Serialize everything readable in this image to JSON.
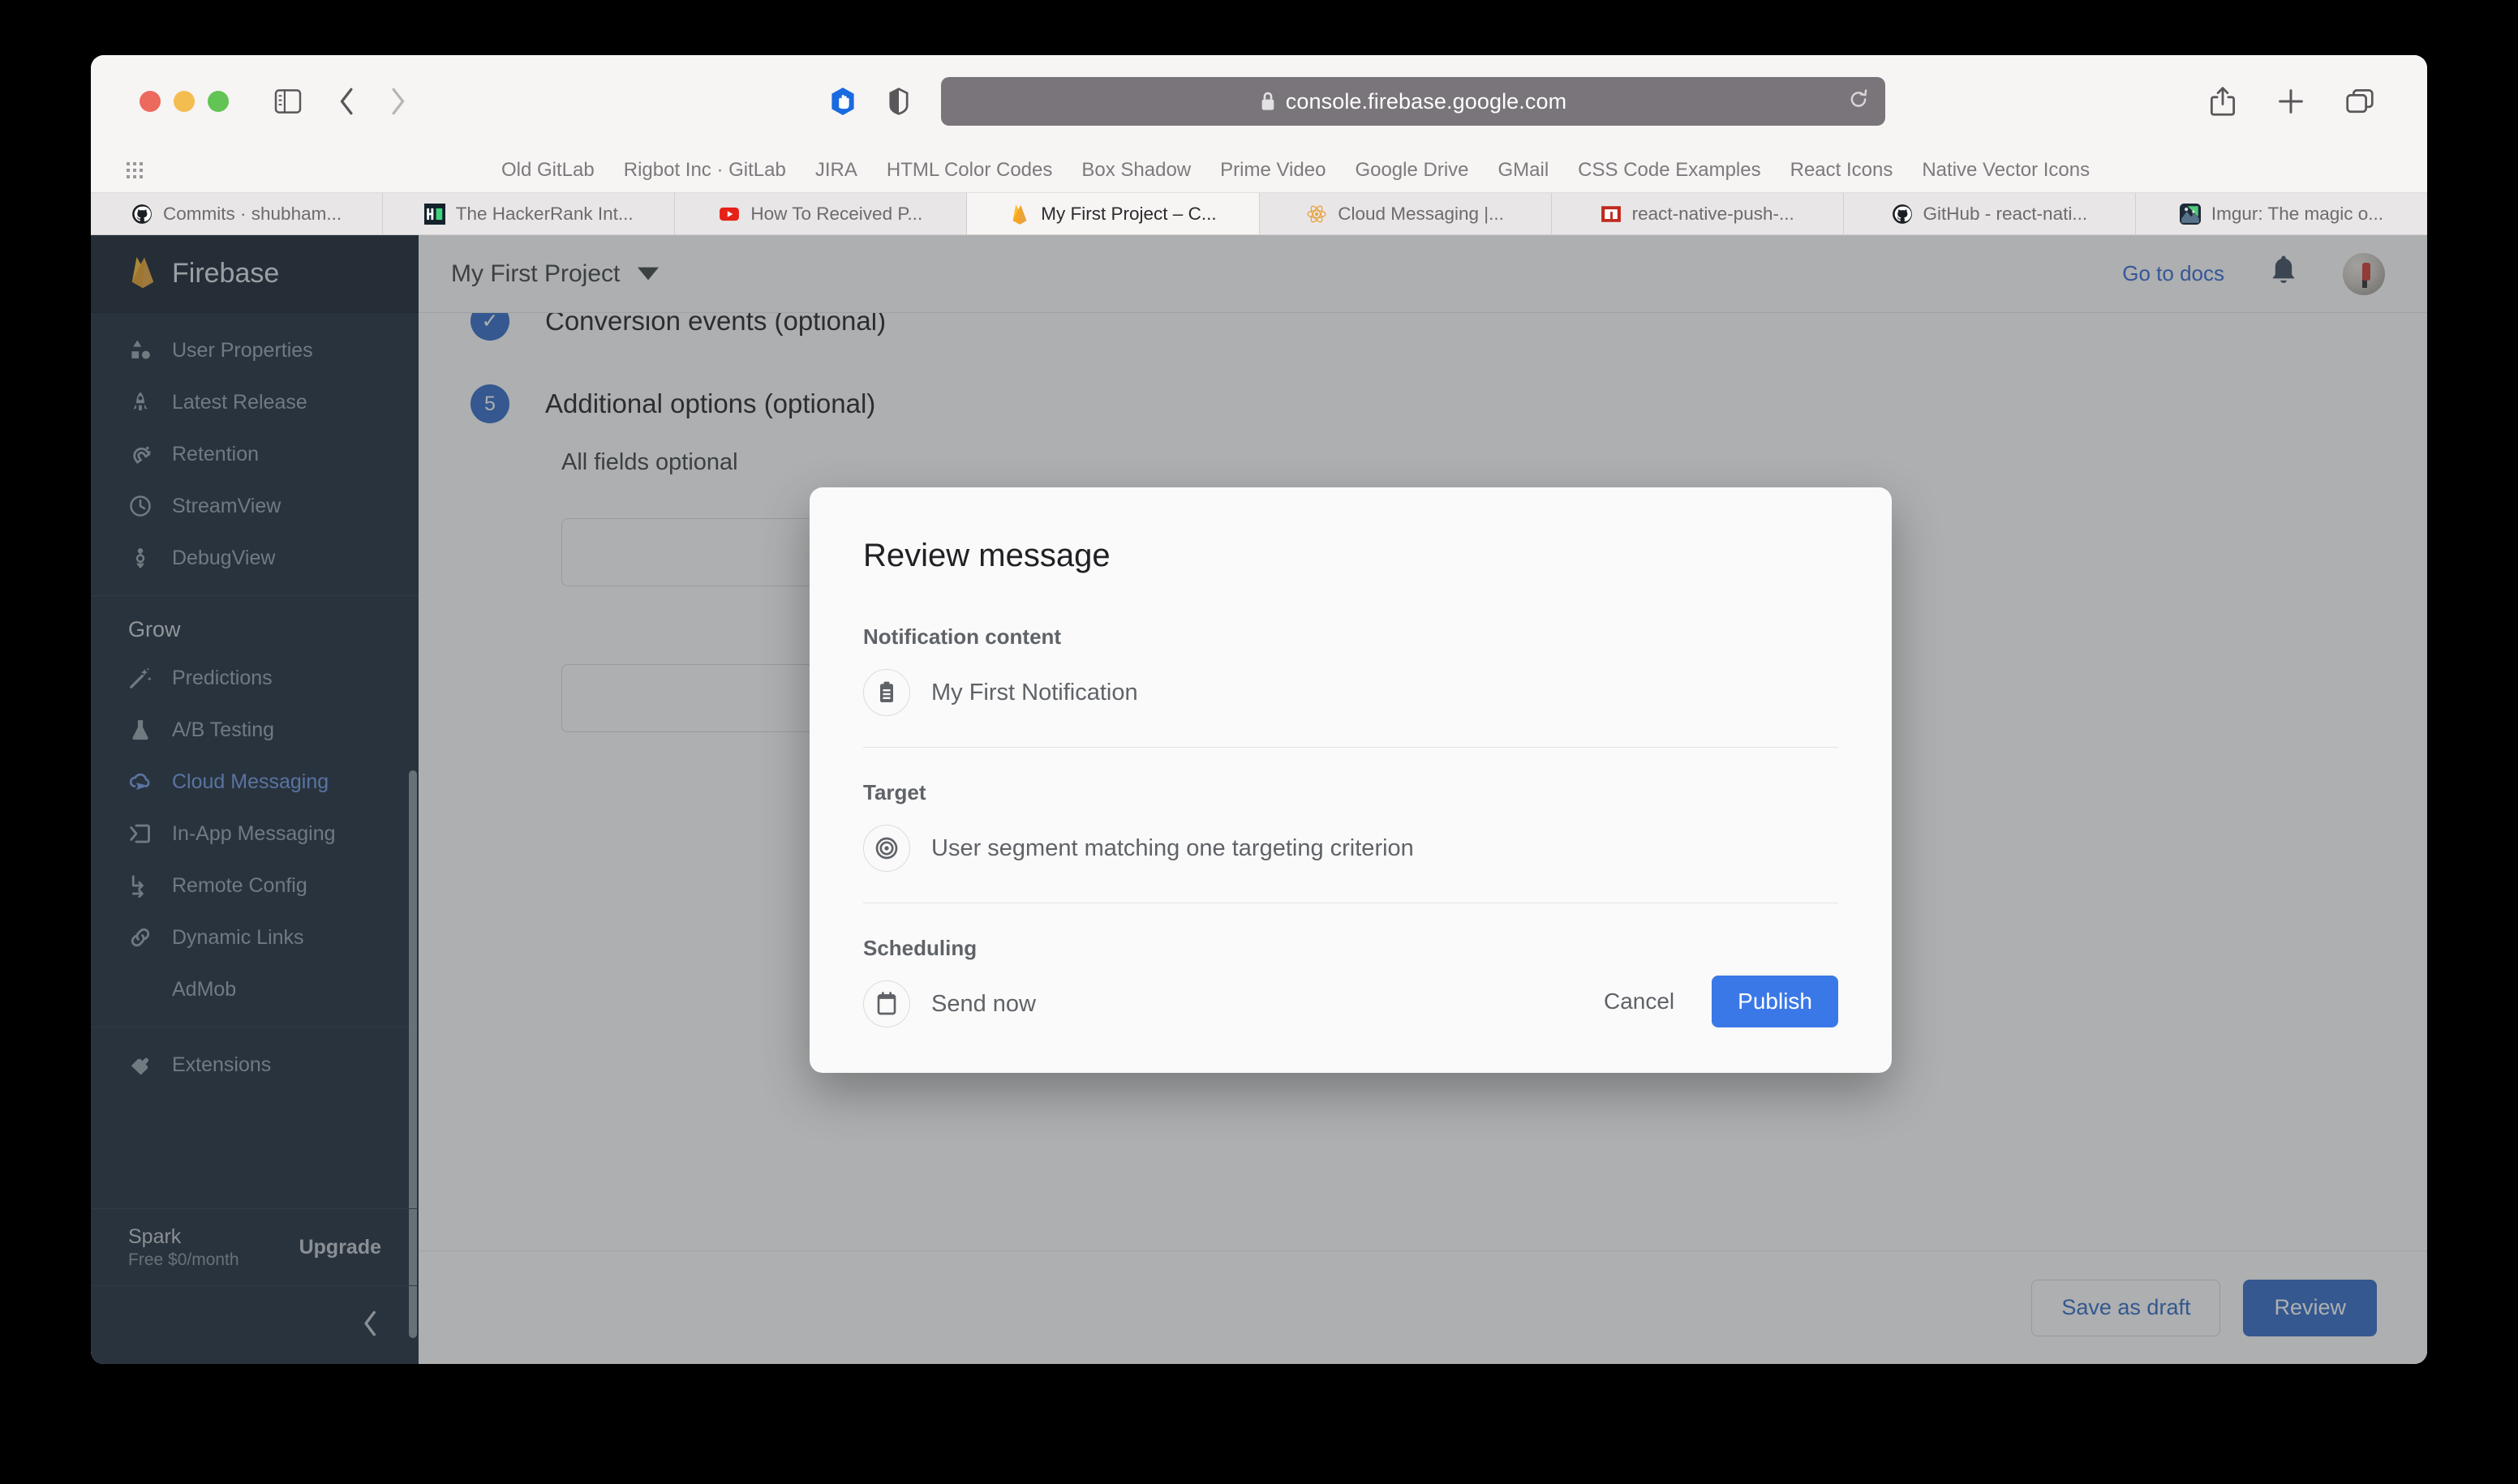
{
  "browser": {
    "url": "console.firebase.google.com",
    "lock_icon": "lock-icon",
    "reload_icon": "reload-icon",
    "sidebar_icon": "sidebar-toggle-icon",
    "back_icon": "chevron-left-icon",
    "forward_icon": "chevron-right-icon",
    "extension_icon": "adblock-shield-icon",
    "privacy_icon": "privacy-report-icon",
    "share_icon": "share-icon",
    "new_tab_icon": "plus-icon",
    "tab_overview_icon": "tab-overview-icon",
    "bookmarks": [
      "Old GitLab",
      "Rigbot Inc · GitLab",
      "JIRA",
      "HTML Color Codes",
      "Box Shadow",
      "Prime Video",
      "Google Drive",
      "GMail",
      "CSS Code Examples",
      "React Icons",
      "Native Vector Icons"
    ],
    "tabs": [
      {
        "title": "Commits · shubham...",
        "icon": "github-icon",
        "active": false
      },
      {
        "title": "The HackerRank Int...",
        "icon": "hackerrank-icon",
        "active": false
      },
      {
        "title": "How To Received P...",
        "icon": "youtube-icon",
        "active": false
      },
      {
        "title": "My First Project – C...",
        "icon": "firebase-icon",
        "active": true
      },
      {
        "title": "Cloud Messaging |...",
        "icon": "react-icon",
        "active": false
      },
      {
        "title": "react-native-push-...",
        "icon": "npm-icon",
        "active": false
      },
      {
        "title": "GitHub - react-nati...",
        "icon": "github-icon",
        "active": false
      },
      {
        "title": "Imgur: The magic o...",
        "icon": "imgur-icon",
        "active": false
      }
    ]
  },
  "sidebar": {
    "brand": "Firebase",
    "brand_icon": "firebase-flame-icon",
    "items_top": [
      {
        "label": "User Properties",
        "icon": "shapes-icon"
      },
      {
        "label": "Latest Release",
        "icon": "rocket-icon"
      },
      {
        "label": "Retention",
        "icon": "magnet-icon"
      },
      {
        "label": "StreamView",
        "icon": "clock-icon"
      },
      {
        "label": "DebugView",
        "icon": "debug-icon"
      }
    ],
    "section_header": "Grow",
    "items_grow": [
      {
        "label": "Predictions",
        "icon": "magic-wand-icon",
        "active": false
      },
      {
        "label": "A/B Testing",
        "icon": "flask-icon",
        "active": false
      },
      {
        "label": "Cloud Messaging",
        "icon": "cloud-send-icon",
        "active": true
      },
      {
        "label": "In-App Messaging",
        "icon": "inapp-icon",
        "active": false
      },
      {
        "label": "Remote Config",
        "icon": "remote-config-icon",
        "active": false
      },
      {
        "label": "Dynamic Links",
        "icon": "link-icon",
        "active": false
      },
      {
        "label": "AdMob",
        "icon": "admob-icon",
        "active": false
      }
    ],
    "items_bottom": [
      {
        "label": "Extensions",
        "icon": "extensions-icon"
      }
    ],
    "plan": {
      "name": "Spark",
      "price": "Free $0/month",
      "upgrade_label": "Upgrade"
    },
    "collapse_icon": "chevron-left-icon"
  },
  "header": {
    "project_name": "My First Project",
    "project_dropdown_icon": "chevron-down-icon",
    "docs_link": "Go to docs",
    "notifications_icon": "bell-icon",
    "avatar": "user-avatar"
  },
  "main": {
    "step_conversion": {
      "badge": "✓",
      "title": "Conversion events (optional)"
    },
    "step_additional": {
      "badge": "5",
      "title": "Additional options (optional)",
      "subtitle": "All fields optional"
    },
    "footer": {
      "save_draft_label": "Save as draft",
      "review_label": "Review"
    }
  },
  "dialog": {
    "title": "Review message",
    "sections": [
      {
        "label": "Notification content",
        "icon": "clipboard-icon",
        "value": "My First Notification"
      },
      {
        "label": "Target",
        "icon": "bullseye-icon",
        "value": "User segment matching one targeting criterion"
      },
      {
        "label": "Scheduling",
        "icon": "calendar-icon",
        "value": "Send now"
      }
    ],
    "cancel_label": "Cancel",
    "publish_label": "Publish",
    "publish_color": "#3b78e7"
  }
}
